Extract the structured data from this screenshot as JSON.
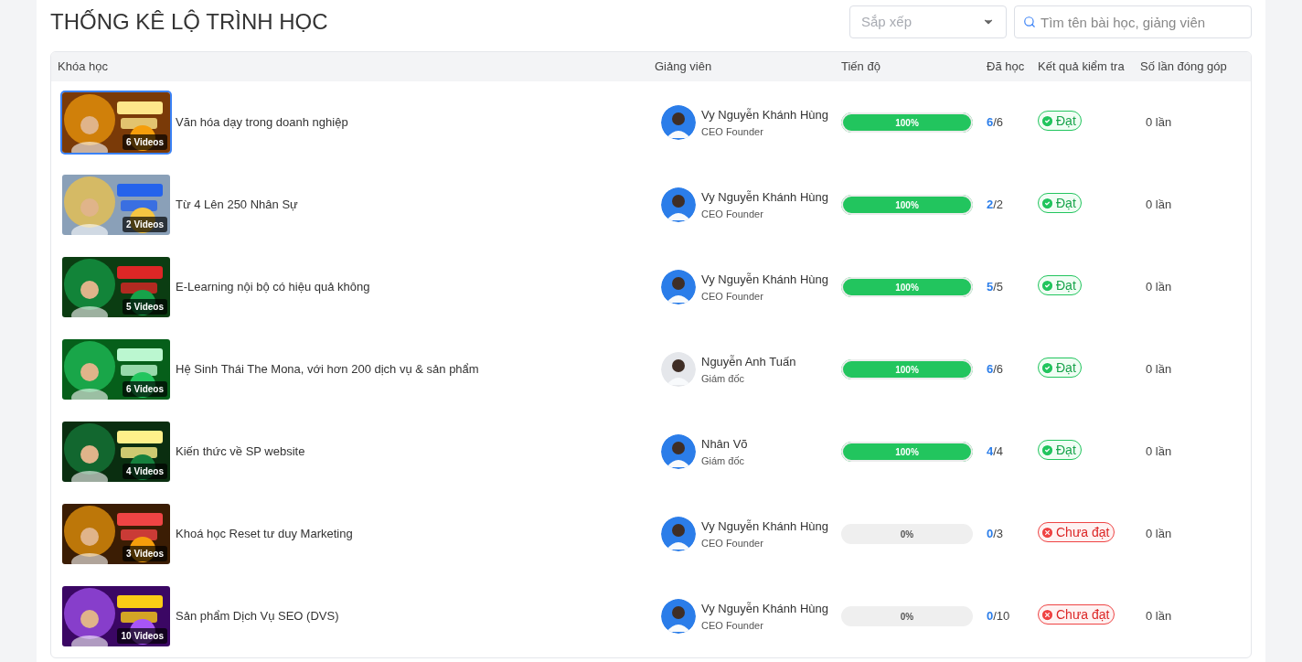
{
  "title": "THỐNG KÊ LỘ TRÌNH HỌC",
  "sort": {
    "placeholder": "Sắp xếp"
  },
  "search": {
    "placeholder": "Tìm tên bài học, giảng viên"
  },
  "table": {
    "columns": [
      "Khóa học",
      "Giảng viên",
      "Tiến độ",
      "Đã học",
      "Kết quả kiểm tra",
      "Số lần đóng góp"
    ],
    "rows": [
      {
        "videos": "6 Videos",
        "course": "Văn hóa dạy trong doanh nghiệp",
        "lecturer": "Vy Nguyễn Khánh Hùng",
        "role": "CEO Founder",
        "level": 1,
        "progress": "100%",
        "done": "6",
        "total": "/6",
        "result": {
          "kind": "pass",
          "label": "Đạt"
        },
        "contributions": "0 lần"
      },
      {
        "videos": "2 Videos",
        "course": "Từ 4 Lên 250 Nhân Sự",
        "lecturer": "Vy Nguyễn Khánh Hùng",
        "role": "CEO Founder",
        "level": 1,
        "progress": "100%",
        "done": "2",
        "total": "/2",
        "result": {
          "kind": "pass",
          "label": "Đạt"
        },
        "contributions": "0 lần"
      },
      {
        "videos": "5 Videos",
        "course": "E-Learning nội bộ có hiệu quả không",
        "lecturer": "Vy Nguyễn Khánh Hùng",
        "role": "CEO Founder",
        "level": 1,
        "progress": "100%",
        "done": "5",
        "total": "/5",
        "result": {
          "kind": "pass",
          "label": "Đạt"
        },
        "contributions": "0 lần"
      },
      {
        "videos": "6 Videos",
        "course": "Hệ Sinh Thái The Mona, với hơn 200 dịch vụ & sản phẩm",
        "lecturer": "Nguyễn Anh Tuấn",
        "role": "Giám đốc",
        "level": 1,
        "progress": "100%",
        "done": "6",
        "total": "/6",
        "result": {
          "kind": "pass",
          "label": "Đạt"
        },
        "contributions": "0 lần"
      },
      {
        "videos": "4 Videos",
        "course": "Kiến thức về SP website",
        "lecturer": "Nhân Võ",
        "role": "Giám đốc",
        "level": 1,
        "progress": "100%",
        "done": "4",
        "total": "/4",
        "result": {
          "kind": "pass",
          "label": "Đạt"
        },
        "contributions": "0 lần"
      },
      {
        "videos": "3 Videos",
        "course": "Khoá học Reset tư duy Marketing",
        "lecturer": "Vy Nguyễn Khánh Hùng",
        "role": "CEO Founder",
        "level": 0,
        "progress": "0%",
        "done": "0",
        "total": "/3",
        "result": {
          "kind": "fail",
          "label": "Chưa đạt"
        },
        "contributions": "0 lần"
      },
      {
        "videos": "10 Videos",
        "course": "Sản phẩm Dịch Vụ SEO (DVS)",
        "lecturer": "Vy Nguyễn Khánh Hùng",
        "role": "CEO Founder",
        "level": 0,
        "progress": "0%",
        "done": "0",
        "total": "/10",
        "result": {
          "kind": "fail",
          "label": "Chưa đạt"
        },
        "contributions": "0 lần"
      }
    ]
  }
}
